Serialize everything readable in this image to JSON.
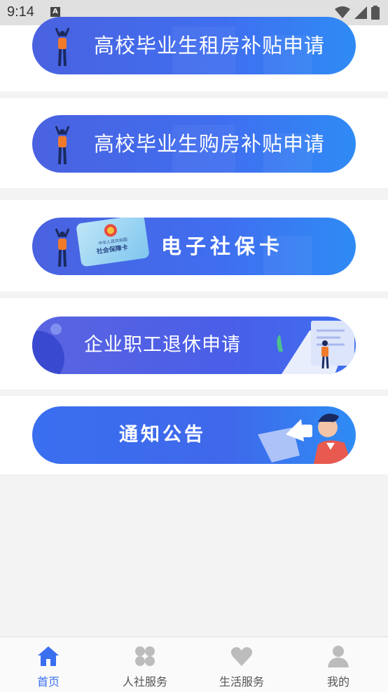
{
  "status": {
    "time": "9:14",
    "notification": "A"
  },
  "banners": [
    {
      "label": "高校毕业生租房补贴申请"
    },
    {
      "label": "高校毕业生购房补贴申请"
    },
    {
      "label": "电子社保卡",
      "card_text1": "中华人民共和国",
      "card_text2": "社会保障卡"
    },
    {
      "label": "企业职工退休申请"
    },
    {
      "label": "通知公告"
    }
  ],
  "tabs": [
    {
      "label": "首页",
      "icon": "home-icon",
      "active": true
    },
    {
      "label": "人社服务",
      "icon": "grid-clover-icon",
      "active": false
    },
    {
      "label": "生活服务",
      "icon": "heart-icon",
      "active": false
    },
    {
      "label": "我的",
      "icon": "user-icon",
      "active": false
    }
  ],
  "colors": {
    "accent": "#3a6ff0",
    "banner_start": "#4a62e0",
    "banner_end": "#2f8bf5"
  }
}
